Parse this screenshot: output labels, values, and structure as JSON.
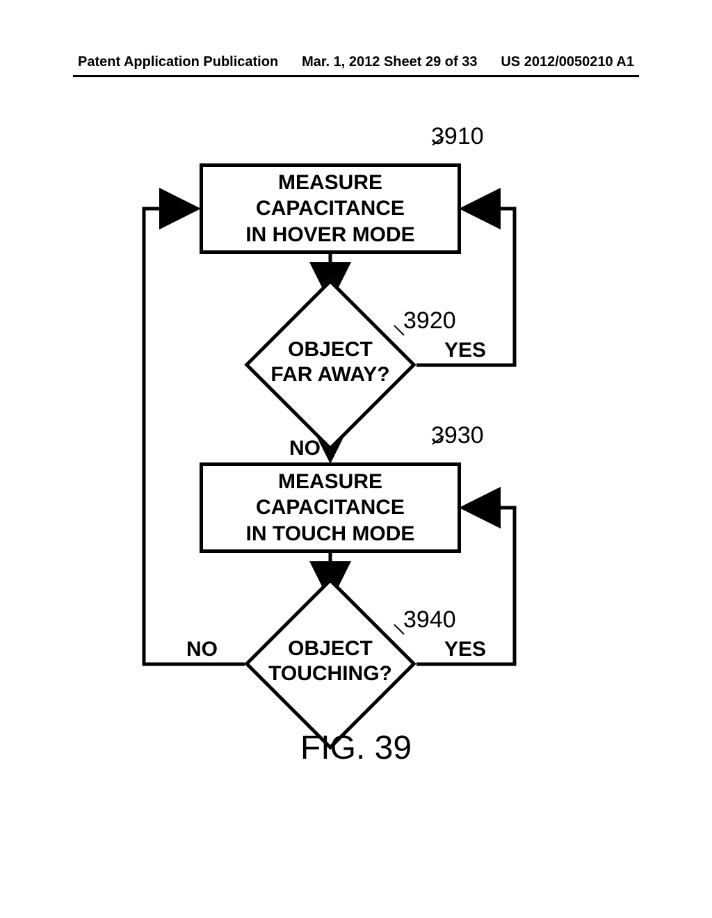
{
  "header": {
    "left": "Patent Application Publication",
    "center": "Mar. 1, 2012  Sheet 29 of 33",
    "right": "US 2012/0050210 A1"
  },
  "flowchart": {
    "box1": {
      "line1": "MEASURE CAPACITANCE",
      "line2": "IN HOVER MODE",
      "ref": "3910"
    },
    "diamond1": {
      "line1": "OBJECT",
      "line2": "FAR AWAY?",
      "ref": "3920",
      "yes": "YES",
      "no": "NO"
    },
    "box2": {
      "line1": "MEASURE CAPACITANCE",
      "line2": "IN TOUCH MODE",
      "ref": "3930"
    },
    "diamond2": {
      "line1": "OBJECT",
      "line2": "TOUCHING?",
      "ref": "3940",
      "yes": "YES",
      "no": "NO"
    }
  },
  "figure_label": "FIG. 39"
}
